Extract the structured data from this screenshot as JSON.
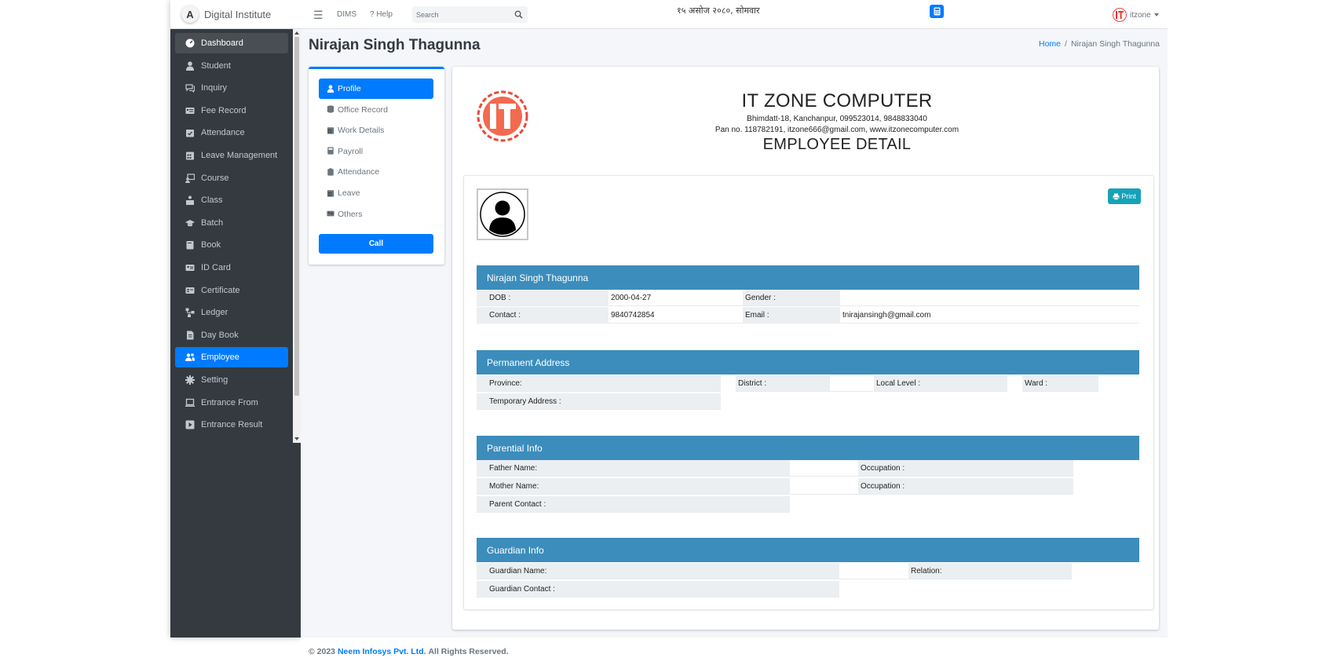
{
  "brand": {
    "logo_letter": "A",
    "name": "Digital Institute"
  },
  "sidebar": {
    "items": [
      {
        "label": "Dashboard",
        "icon": "tachometer-icon"
      },
      {
        "label": "Student",
        "icon": "user-icon"
      },
      {
        "label": "Inquiry",
        "icon": "comments-icon"
      },
      {
        "label": "Fee Record",
        "icon": "id-list-icon"
      },
      {
        "label": "Attendance",
        "icon": "calendar-check-icon"
      },
      {
        "label": "Leave Management",
        "icon": "calendar-icon"
      },
      {
        "label": "Course",
        "icon": "chalkboard-teacher-icon"
      },
      {
        "label": "Class",
        "icon": "school-icon"
      },
      {
        "label": "Batch",
        "icon": "graduation-cap-icon"
      },
      {
        "label": "Book",
        "icon": "book-icon"
      },
      {
        "label": "ID Card",
        "icon": "id-card-icon"
      },
      {
        "label": "Certificate",
        "icon": "certificate-card-icon"
      },
      {
        "label": "Ledger",
        "icon": "sitemap-icon"
      },
      {
        "label": "Day Book",
        "icon": "file-invoice-icon"
      },
      {
        "label": "Employee",
        "icon": "users-icon"
      },
      {
        "label": "Setting",
        "icon": "gear-icon"
      },
      {
        "label": "Entrance From",
        "icon": "laptop-icon"
      },
      {
        "label": "Entrance Result",
        "icon": "square-caret-icon"
      }
    ]
  },
  "topbar": {
    "dims_label": "DIMS",
    "help_label": "? Help",
    "search_placeholder": "Search",
    "date": "१५ असोज २०८०, सोमवार",
    "user_name": "itzone"
  },
  "page": {
    "title": "Nirajan Singh Thagunna",
    "breadcrumb_home": "Home",
    "breadcrumb_sep": "/",
    "breadcrumb_current": "Nirajan Singh Thagunna"
  },
  "profile_tabs": [
    {
      "label": "Profile",
      "icon": "user-icon"
    },
    {
      "label": "Office Record",
      "icon": "database-icon"
    },
    {
      "label": "Work Details",
      "icon": "calendar-icon"
    },
    {
      "label": "Payroll",
      "icon": "calculator-icon"
    },
    {
      "label": "Attendance",
      "icon": "clipboard-icon"
    },
    {
      "label": "Leave",
      "icon": "calendar-icon"
    },
    {
      "label": "Others",
      "icon": "id-card-icon"
    }
  ],
  "call_button": "Call",
  "company": {
    "name": "IT ZONE COMPUTER",
    "address": "Bhimdatt-18, Kanchanpur, 099523014, 9848833040",
    "pan": "Pan no. 118782191, itzone666@gmail.com, www.itzonecomputer.com",
    "doc_title": "EMPLOYEE DETAIL",
    "logo_text": "IT"
  },
  "print_button": "Print",
  "personal": {
    "heading": "Nirajan Singh Thagunna",
    "dob_label": "DOB :",
    "dob": "2000-04-27",
    "gender_label": "Gender :",
    "gender": "",
    "contact_label": "Contact :",
    "contact": "9840742854",
    "email_label": "Email :",
    "email": "tnirajansingh@gmail.com"
  },
  "permanent": {
    "heading": "Permanent Address",
    "province_label": "Province:",
    "district_label": "District :",
    "local_label": "Local Level :",
    "ward_label": "Ward :",
    "temp_label": "Temporary Address :"
  },
  "parental": {
    "heading": "Parential Info",
    "father_label": "Father Name:",
    "occupation1_label": "Occupation :",
    "mother_label": "Mother Name:",
    "occupation2_label": "Occupation :",
    "parent_contact_label": "Parent Contact :"
  },
  "guardian": {
    "heading": "Guardian Info",
    "name_label": "Guardian Name:",
    "relation_label": "Relation:",
    "contact_label": "Guardian Contact :"
  },
  "footer": {
    "copyright": "© 2023",
    "company": "Neem Infosys Pvt. Ltd.",
    "rights": "All Rights Reserved."
  },
  "colors": {
    "primary": "#007bff",
    "section": "#3c8dbc",
    "sidebar": "#343a40",
    "print": "#17a2b8"
  }
}
